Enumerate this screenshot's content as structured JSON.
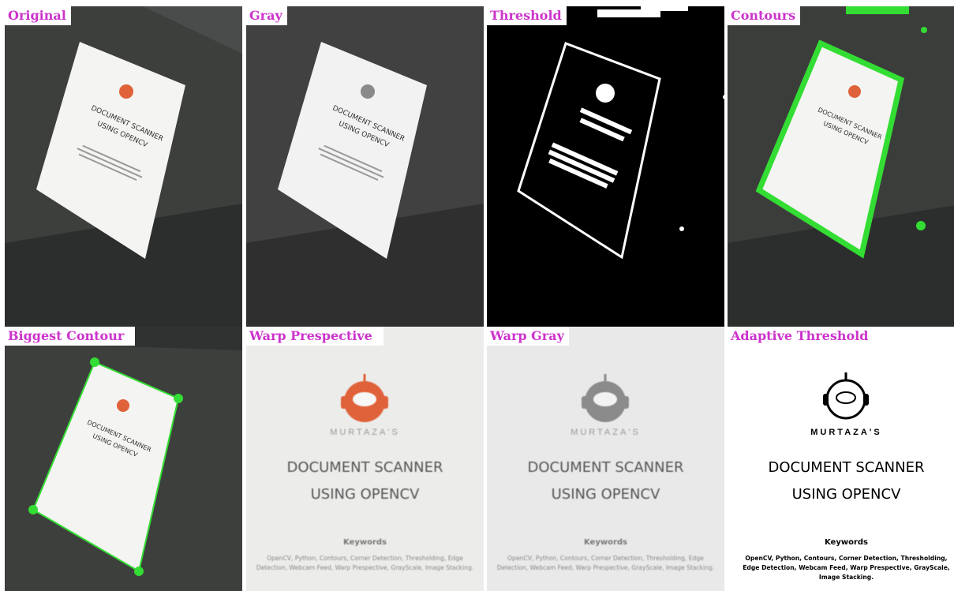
{
  "panels": {
    "original": {
      "label": "Original"
    },
    "gray": {
      "label": "Gray"
    },
    "threshold": {
      "label": "Threshold"
    },
    "contours": {
      "label": "Contours"
    },
    "biggest_contour": {
      "label": "Biggest Contour"
    },
    "warp_prespective": {
      "label": "Warp Prespective"
    },
    "warp_gray": {
      "label": "Warp Gray"
    },
    "adaptive_threshold": {
      "label": "Adaptive Threshold"
    }
  },
  "document": {
    "brand": "MURTAZA'S",
    "title_line1": "DOCUMENT SCANNER",
    "title_line2": "USING OPENCV",
    "keywords_heading": "Keywords",
    "keywords_text": "OpenCV, Python, Contours, Corner Detection, Thresholding, Edge Detection, Webcam Feed, Warp Prespective, GrayScale, Image Stacking."
  },
  "colors": {
    "label_text": "#cc33cc",
    "contour_green": "#33dd33",
    "logo_orange": "#e0623a",
    "desk_dark": "#3b3d3b"
  }
}
